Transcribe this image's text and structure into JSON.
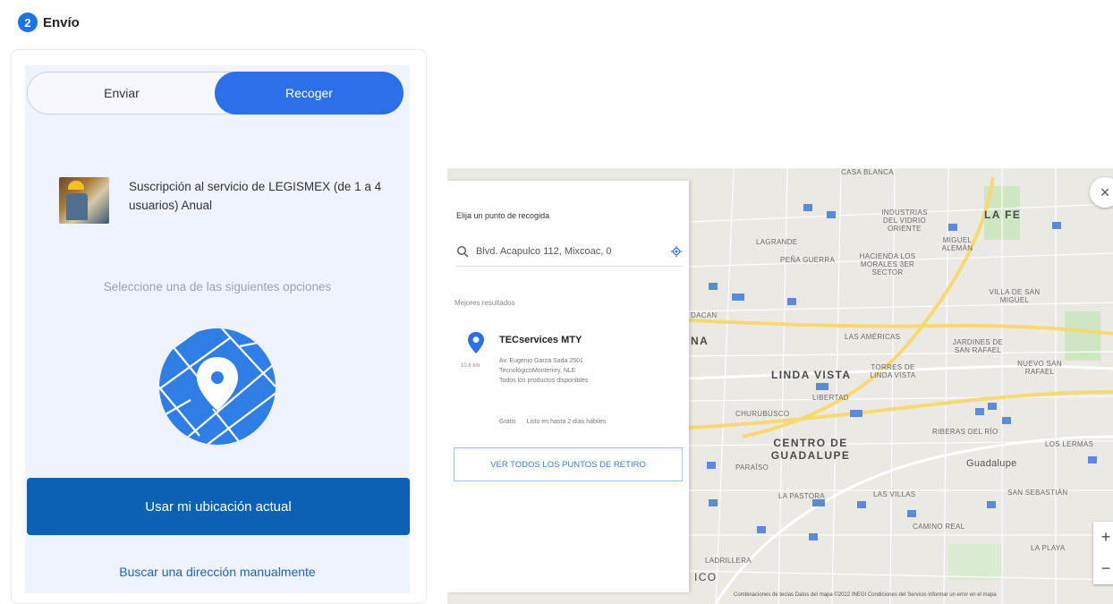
{
  "step": {
    "number": "2",
    "title": "Envío"
  },
  "delivery_toggle": {
    "send_label": "Enviar",
    "pickup_label": "Recoger",
    "selected": "Recoger"
  },
  "product": {
    "name": "Suscripción al servicio de LEGISMEX (de 1 a 4 usuarios) Anual"
  },
  "instruction": "Seleccione una de las siguientes opciones",
  "actions": {
    "use_location": "Usar mi ubicación actual",
    "manual_search": "Buscar una dirección manualmente"
  },
  "map_panel": {
    "title": "Elija un punto de recogida",
    "search_value": "Blvd. Acapulco 112, Mixcoac, 0",
    "results_heading": "Mejores resultados",
    "results": [
      {
        "name": "TECservices MTY",
        "distance": "10.6 km",
        "address_line1": "Av. Eugenio Garza Sada 2501",
        "address_line2": "TecnológicoMonterrey, NLE",
        "availability": "Todos los productos disponibles",
        "price": "Gratis",
        "ready": "Listo en hasta 2 días hábiles"
      }
    ],
    "view_all_button": "VER TODOS LOS PUNTOS DE RETIRO"
  },
  "map": {
    "labels": [
      "CASA BLANCA",
      "LA FE",
      "INDUSTRIAS DEL VIDRIO ORIENTE",
      "MIGUEL ALEMÁN",
      "LAGRANDE",
      "PEÑA GUERRA",
      "HACIENDA LOS MORALES 3ER SECTOR",
      "VILLA DE SAN MIGUEL",
      "LAS AMÉRICAS",
      "JARDINES DE SAN RAFAEL",
      "NUEVO SAN RAFAEL",
      "LINDA VISTA",
      "TORRES DE LINDA VISTA",
      "LIBERTAD",
      "CHURUBUSCO",
      "RIBERAS DEL RÍO",
      "LOS LERMAS",
      "CENTRO DE GUADALUPE",
      "Guadalupe",
      "PARAÍSO",
      "LA PASTORA",
      "LAS VILLAS",
      "SAN SEBASTIÁN",
      "CAMINO REAL",
      "LA PLAYA",
      "LADRILLERA",
      "ICO",
      "NA",
      "DACAN"
    ],
    "footer": "Combinaciones de teclas   Datos del mapa ©2022 INEGI   Condiciones del Servicio   Informar un error en el mapa",
    "zoom_in": "+",
    "zoom_out": "−",
    "close": "×"
  },
  "colors": {
    "accent": "#2d6fe8",
    "primary_button": "#0c61b5",
    "link": "#1a63c2",
    "panel_bg": "#eef3fd"
  },
  "icons": {
    "step_badge": "circle-number",
    "search": "search-icon",
    "locate": "crosshair-icon",
    "pin": "map-pin-icon",
    "close": "close-icon"
  }
}
